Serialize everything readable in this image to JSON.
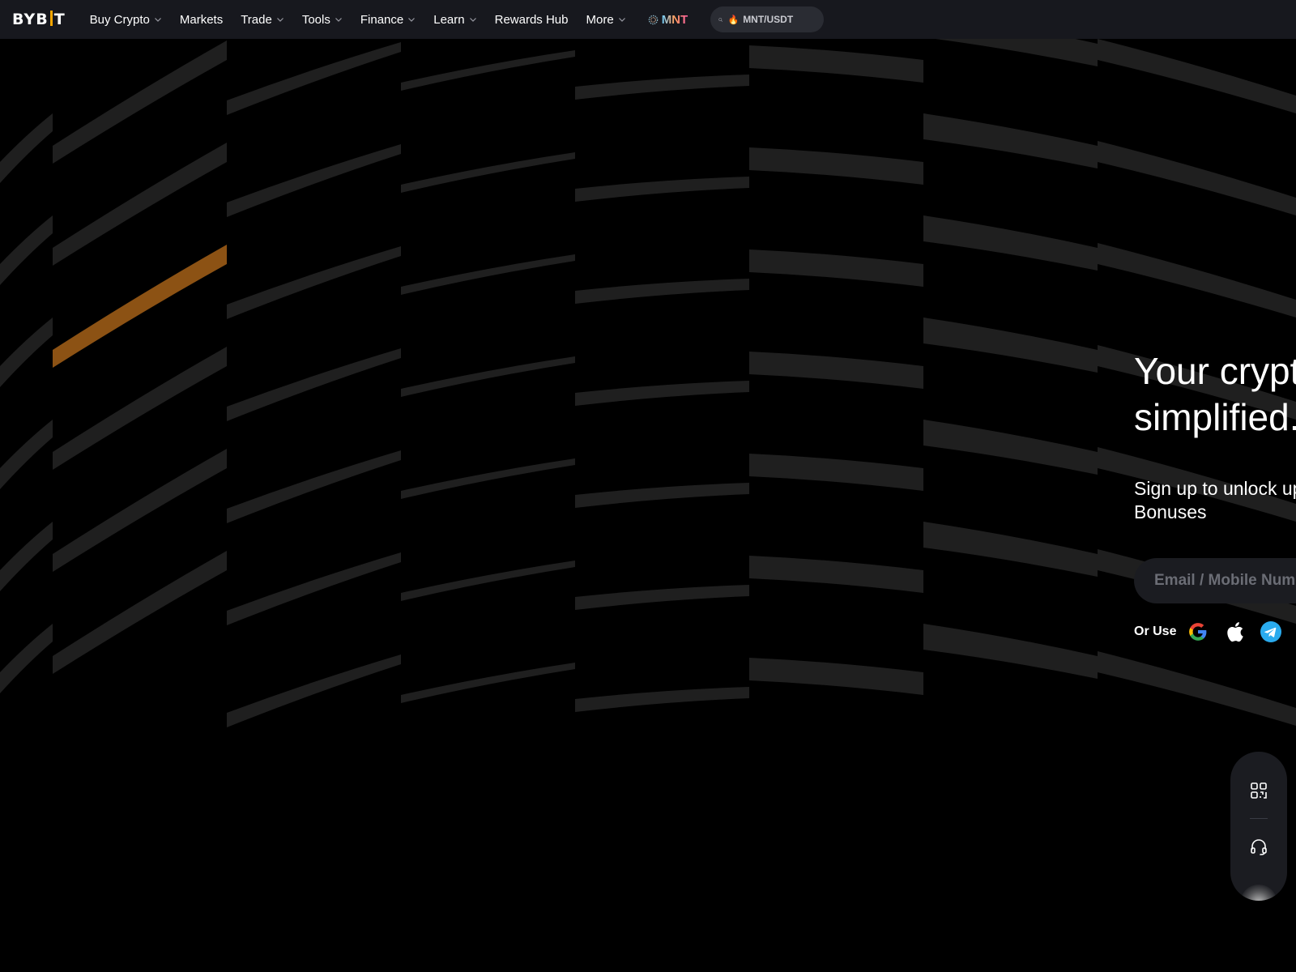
{
  "brand": {
    "logo_left": "BYB",
    "logo_right": "T",
    "accent": "#f7a600"
  },
  "nav": {
    "items": [
      {
        "label": "Buy Crypto",
        "dropdown": true
      },
      {
        "label": "Markets",
        "dropdown": false
      },
      {
        "label": "Trade",
        "dropdown": true
      },
      {
        "label": "Tools",
        "dropdown": true
      },
      {
        "label": "Finance",
        "dropdown": true
      },
      {
        "label": "Learn",
        "dropdown": true
      },
      {
        "label": "Rewards Hub",
        "dropdown": false
      },
      {
        "label": "More",
        "dropdown": true
      }
    ],
    "mnt_label": "MNT",
    "search_placeholder": "MNT/USDT",
    "search_icon": "search-icon",
    "hot_icon": "fire-icon"
  },
  "hero": {
    "title_line1": "Your crypto",
    "title_line2": "simplified.",
    "subtitle_line1": "Sign up to unlock up",
    "subtitle_line2": "Bonuses",
    "email_placeholder": "Email / Mobile Number",
    "or_use": "Or Use",
    "social": [
      "google-icon",
      "apple-icon",
      "telegram-icon"
    ]
  },
  "float_widget": {
    "icons": [
      "qr-code-icon",
      "headset-icon"
    ]
  },
  "colors": {
    "nav_bg": "#17181e",
    "page_bg": "#000000",
    "stripe": "#1f1f1f",
    "stripe_highlight": "#8c5214",
    "input_bg": "#1b1c21"
  }
}
